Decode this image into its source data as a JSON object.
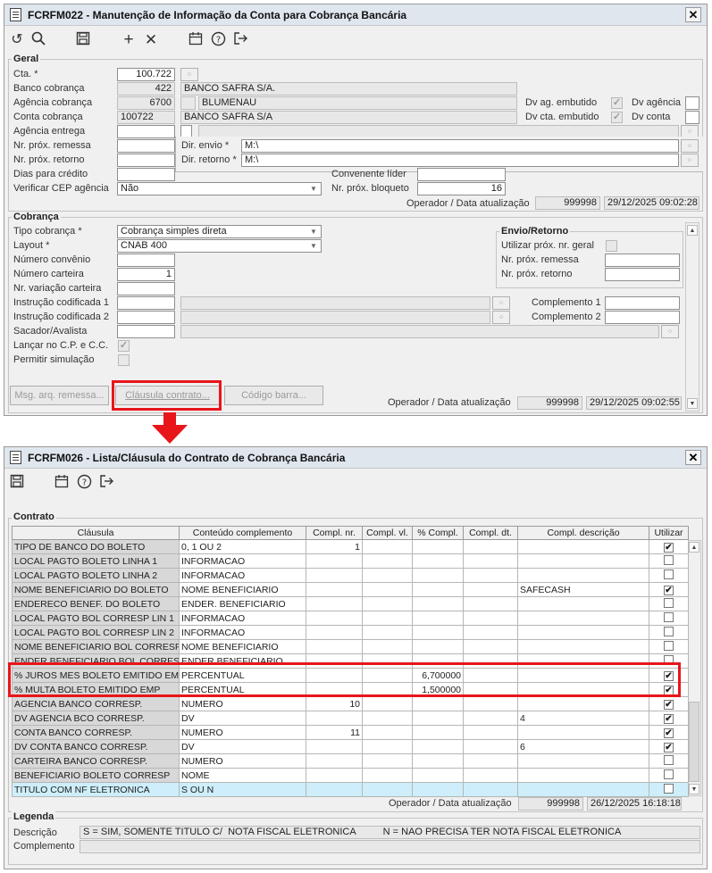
{
  "win1": {
    "title": "FCRFM022 - Manutenção de Informação da Conta para Cobrança Bancária",
    "close": "✕",
    "geral": {
      "title": "Geral",
      "cta_label": "Cta. *",
      "cta_value": "100.722",
      "banco_label": "Banco cobrança",
      "banco_code": "422",
      "banco_name": "BANCO SAFRA S/A.",
      "agencia_label": "Agência cobrança",
      "agencia_code": "6700",
      "agencia_name": "BLUMENAU",
      "conta_label": "Conta cobrança",
      "conta_code": "100722",
      "conta_name": "BANCO SAFRA S/A",
      "ag_entrega_label": "Agência entrega",
      "remessa_label": "Nr. próx. remessa",
      "retorno_label": "Nr. próx. retorno",
      "dias_label": "Dias para crédito",
      "cep_label": "Verificar CEP agência",
      "cep_value": "Não",
      "dv_ag_emb_label": "Dv ag. embutido",
      "dv_agencia_label": "Dv agência",
      "dv_cta_emb_label": "Dv cta. embutido",
      "dv_conta_label": "Dv conta",
      "dir_envio_label": "Dir. envio *",
      "dir_envio_value": "M:\\",
      "dir_retorno_label": "Dir. retorno *",
      "dir_retorno_value": "M:\\",
      "conv_lider_label": "Convenente líder",
      "bloqueto_label": "Nr. próx. bloqueto",
      "bloqueto_value": "16",
      "op_label": "Operador / Data atualização",
      "op_value": "999998",
      "op_date": "29/12/2025 09:02:28"
    },
    "cobranca": {
      "title": "Cobrança",
      "tipo_label": "Tipo cobrança *",
      "tipo_value": "Cobrança simples direta",
      "layout_label": "Layout *",
      "layout_value": "CNAB 400",
      "convenio_label": "Número convênio",
      "carteira_label": "Número carteira",
      "carteira_value": "1",
      "variacao_label": "Nr. variação carteira",
      "instr1_label": "Instrução codificada 1",
      "instr2_label": "Instrução codificada 2",
      "sacador_label": "Sacador/Avalista",
      "lancar_label": "Lançar no C.P. e C.C.",
      "permitir_label": "Permitir simulação",
      "complemento1_label": "Complemento 1",
      "complemento2_label": "Complemento 2",
      "envio_title": "Envio/Retorno",
      "util_label": "Utilizar próx. nr. geral",
      "remessa_label": "Nr. próx. remessa",
      "retorno_label": "Nr. próx. retorno",
      "btn_msg": "Msg. arq. remessa...",
      "btn_clausula": "Cláusula contrato...",
      "btn_codigo": "Código barra...",
      "op_label": "Operador / Data atualização",
      "op_value": "999998",
      "op_date": "29/12/2025 09:02:55"
    }
  },
  "win2": {
    "title": "FCRFM026 - Lista/Cláusula do Contrato de Cobrança Bancária",
    "close": "✕",
    "group_title": "Contrato",
    "columns": [
      "Cláusula",
      "Conteúdo complemento",
      "Compl. nr.",
      "Compl. vl.",
      "% Compl.",
      "Compl. dt.",
      "Compl. descrição",
      "Utilizar"
    ],
    "rows": [
      {
        "clausula": "TIPO DE BANCO DO BOLETO",
        "conteudo": "0, 1 OU 2",
        "nr": "1",
        "vl": "",
        "pct": "",
        "dt": "",
        "desc": "",
        "util": "✔"
      },
      {
        "clausula": "LOCAL PAGTO BOLETO LINHA 1",
        "conteudo": "INFORMACAO",
        "nr": "",
        "vl": "",
        "pct": "",
        "dt": "",
        "desc": "",
        "util": ""
      },
      {
        "clausula": "LOCAL PAGTO BOLETO LINHA 2",
        "conteudo": "INFORMACAO",
        "nr": "",
        "vl": "",
        "pct": "",
        "dt": "",
        "desc": "",
        "util": ""
      },
      {
        "clausula": "NOME BENEFICIARIO DO BOLETO",
        "conteudo": "NOME BENEFICIARIO",
        "nr": "",
        "vl": "",
        "pct": "",
        "dt": "",
        "desc": "SAFECASH",
        "util": "✔"
      },
      {
        "clausula": "ENDERECO BENEF. DO BOLETO",
        "conteudo": "ENDER. BENEFICIARIO",
        "nr": "",
        "vl": "",
        "pct": "",
        "dt": "",
        "desc": "",
        "util": ""
      },
      {
        "clausula": "LOCAL PAGTO BOL CORRESP LIN 1",
        "conteudo": "INFORMACAO",
        "nr": "",
        "vl": "",
        "pct": "",
        "dt": "",
        "desc": "",
        "util": ""
      },
      {
        "clausula": "LOCAL PAGTO BOL CORRESP LIN 2",
        "conteudo": "INFORMACAO",
        "nr": "",
        "vl": "",
        "pct": "",
        "dt": "",
        "desc": "",
        "util": ""
      },
      {
        "clausula": "NOME BENEFICIARIO BOL CORRESP",
        "conteudo": "NOME BENEFICIARIO",
        "nr": "",
        "vl": "",
        "pct": "",
        "dt": "",
        "desc": "",
        "util": ""
      },
      {
        "clausula": "ENDER BENEFICIARIO BOL CORRESP",
        "conteudo": "ENDER BENEFICIARIO",
        "nr": "",
        "vl": "",
        "pct": "",
        "dt": "",
        "desc": "",
        "util": ""
      },
      {
        "clausula": "% JUROS MES BOLETO EMITIDO EMP",
        "conteudo": "PERCENTUAL",
        "nr": "",
        "vl": "",
        "pct": "6,700000",
        "dt": "",
        "desc": "",
        "util": "✔"
      },
      {
        "clausula": "% MULTA BOLETO EMITIDO EMP",
        "conteudo": "PERCENTUAL",
        "nr": "",
        "vl": "",
        "pct": "1,500000",
        "dt": "",
        "desc": "",
        "util": "✔"
      },
      {
        "clausula": "AGENCIA BANCO CORRESP.",
        "conteudo": "NUMERO",
        "nr": "10",
        "vl": "",
        "pct": "",
        "dt": "",
        "desc": "",
        "util": "✔"
      },
      {
        "clausula": "DV AGENCIA BCO CORRESP.",
        "conteudo": "DV",
        "nr": "",
        "vl": "",
        "pct": "",
        "dt": "",
        "desc": "4",
        "util": "✔"
      },
      {
        "clausula": "CONTA BANCO CORRESP.",
        "conteudo": "NUMERO",
        "nr": "11",
        "vl": "",
        "pct": "",
        "dt": "",
        "desc": "",
        "util": "✔"
      },
      {
        "clausula": "DV CONTA BANCO CORRESP.",
        "conteudo": "DV",
        "nr": "",
        "vl": "",
        "pct": "",
        "dt": "",
        "desc": "6",
        "util": "✔"
      },
      {
        "clausula": "CARTEIRA BANCO CORRESP.",
        "conteudo": "NUMERO",
        "nr": "",
        "vl": "",
        "pct": "",
        "dt": "",
        "desc": "",
        "util": ""
      },
      {
        "clausula": "BENEFICIARIO BOLETO CORRESP",
        "conteudo": "NOME",
        "nr": "",
        "vl": "",
        "pct": "",
        "dt": "",
        "desc": "",
        "util": ""
      },
      {
        "clausula": "TITULO COM NF ELETRONICA",
        "conteudo": "S OU N",
        "nr": "",
        "vl": "",
        "pct": "",
        "dt": "",
        "desc": "",
        "util": ""
      }
    ],
    "op_label": "Operador / Data atualização",
    "op_value": "999998",
    "op_date": "26/12/2025 16:18:18",
    "legenda_title": "Legenda",
    "descricao_label": "Descrição",
    "descricao_value": "S = SIM, SOMENTE TITULO C/  NOTA FISCAL ELETRONICA          N = NAO PRECISA TER NOTA FISCAL ELETRONICA",
    "complemento_label": "Complemento"
  }
}
